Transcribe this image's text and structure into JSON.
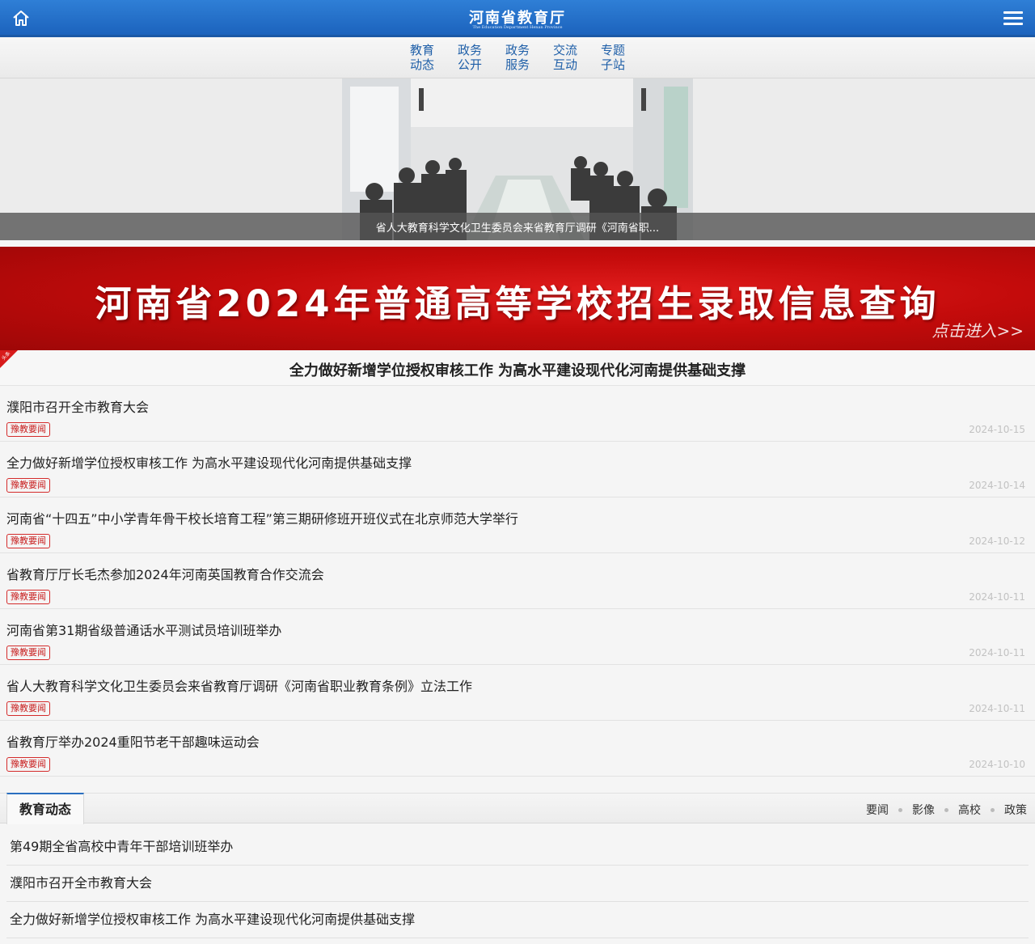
{
  "header": {
    "title": "河南省教育厅",
    "subtitle": "The Education Department Henan Province",
    "home_icon": "home-icon",
    "menu_icon": "hamburger-menu-icon"
  },
  "nav": [
    {
      "line1": "教育",
      "line2": "动态"
    },
    {
      "line1": "政务",
      "line2": "公开"
    },
    {
      "line1": "政务",
      "line2": "服务"
    },
    {
      "line1": "交流",
      "line2": "互动"
    },
    {
      "line1": "专题",
      "line2": "子站"
    }
  ],
  "slider": {
    "caption": "省人大教育科学文化卫生委员会来省教育厅调研《河南省职..."
  },
  "banner": {
    "title": "河南省2024年普通高等学校招生录取信息查询",
    "enter": "点击进入>>"
  },
  "headline": {
    "corner_tag": "头条",
    "title": "全力做好新增学位授权审核工作 为高水平建设现代化河南提供基础支撑"
  },
  "news": [
    {
      "title": "濮阳市召开全市教育大会",
      "tag": "豫教要闻",
      "date": "2024-10-15"
    },
    {
      "title": "全力做好新增学位授权审核工作 为高水平建设现代化河南提供基础支撑",
      "tag": "豫教要闻",
      "date": "2024-10-14"
    },
    {
      "title": "河南省“十四五”中小学青年骨干校长培育工程”第三期研修班开班仪式在北京师范大学举行",
      "tag": "豫教要闻",
      "date": "2024-10-12"
    },
    {
      "title": "省教育厅厅长毛杰参加2024年河南英国教育合作交流会",
      "tag": "豫教要闻",
      "date": "2024-10-11"
    },
    {
      "title": "河南省第31期省级普通话水平测试员培训班举办",
      "tag": "豫教要闻",
      "date": "2024-10-11"
    },
    {
      "title": "省人大教育科学文化卫生委员会来省教育厅调研《河南省职业教育条例》立法工作",
      "tag": "豫教要闻",
      "date": "2024-10-11"
    },
    {
      "title": "省教育厅举办2024重阳节老干部趣味运动会",
      "tag": "豫教要闻",
      "date": "2024-10-10"
    }
  ],
  "section": {
    "tab": "教育动态",
    "links": [
      "要闻",
      "影像",
      "高校",
      "政策"
    ],
    "items": [
      "第49期全省高校中青年干部培训班举办",
      "濮阳市召开全市教育大会",
      "全力做好新增学位授权审核工作 为高水平建设现代化河南提供基础支撑"
    ]
  },
  "colors": {
    "header_blue": "#1f6ac4",
    "nav_text": "#1f5fa8",
    "banner_red": "#c40b0b",
    "tag_red": "#c81e1e"
  }
}
